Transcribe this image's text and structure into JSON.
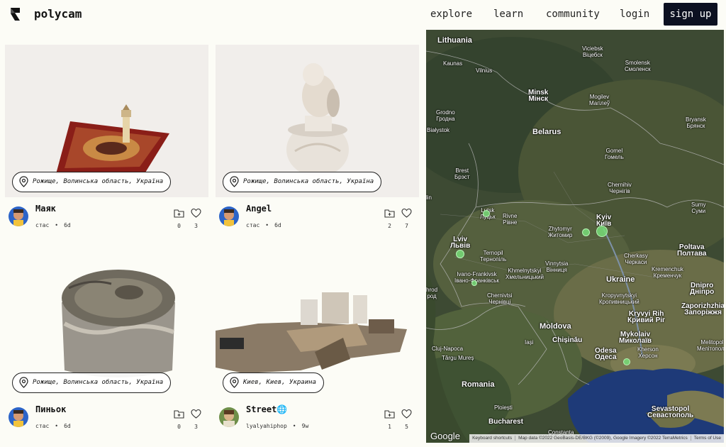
{
  "header": {
    "brand": "polycam",
    "nav": {
      "explore": "explore",
      "learn": "learn",
      "community": "community",
      "login": "login",
      "signup": "sign up"
    }
  },
  "cards": [
    {
      "title": "Маяк",
      "location": "Рожище, Волинська область, Україна",
      "user": "стас",
      "age": "6d",
      "collections": "0",
      "likes": "3",
      "thumb_icon": "carpet-lighthouse-model"
    },
    {
      "title": "Angel",
      "location": "Рожище, Волинська область, Україна",
      "user": "стас",
      "age": "6d",
      "collections": "2",
      "likes": "7",
      "thumb_icon": "angel-figurine-model"
    },
    {
      "title": "Пиньок",
      "location": "Рожище, Волинська область, Україна",
      "user": "стас",
      "age": "6d",
      "collections": "0",
      "likes": "3",
      "thumb_icon": "tree-stump-model"
    },
    {
      "title": "Street🌐",
      "location": "Киев, Киев, Украина",
      "user": "lyalyahiphop",
      "age": "9w",
      "collections": "1",
      "likes": "5",
      "thumb_icon": "street-scan-model"
    }
  ],
  "map": {
    "labels": {
      "lithuania": "Lithuania",
      "kaunas": "Kaunas",
      "vilnius": "Vilnius",
      "vitebsk": "Viciebsk\nВiцебск",
      "smolensk": "Smolensk\nСмоленск",
      "minsk": "Minsk\nМiнск",
      "mogilev": "Mogilev\nМагiлеў",
      "grodno": "Grodno\nГродна",
      "belarus": "Belarus",
      "bialystok": "Białystok",
      "bryansk": "Bryansk\nБрянск",
      "gomel": "Gomel\nГомель",
      "brest": "Brest\nБрэст",
      "chernihiv": "Chernihiv\nЧернiгiв",
      "sumy": "Sumy\nСуми",
      "lutsk": "Lutsk\nЛуцьк",
      "rivne": "Rivne\nРiвне",
      "kyiv": "Kyiv\nКиїв",
      "lublin": "lin",
      "zhytomyr": "Zhytomyr\nЖитомир",
      "lviv": "Lviv\nЛьвiв",
      "ternopil": "Ternopil\nТернопiль",
      "poltava": "Poltava\nПолтава",
      "vinnytsia": "Vinnytsia\nВiнниця",
      "cherkasy": "Cherkasy\nЧеркаси",
      "ivano": "Ivano-Frankivsk\nIвано-Франкiвськ",
      "khmelnytskyi": "Khmelnytskyi\nХмельницький",
      "kremenchuk": "Kremenchuk\nКременчук",
      "ukraine": "Ukraine",
      "dnipro": "Dnipro\nДнiпро",
      "kropyvnytskyi": "Kropyvnytskyi\nКропивницький",
      "chernivtsi": "Chernivtsi\nЧернiвцi",
      "uzhhorod": "hrod\nрод",
      "zaporizhzhia": "Zaporizhzhia\nЗапорiжжя",
      "kryvyi": "Kryvyi Rih\nКривий Рiг",
      "moldova": "Moldova",
      "iasi": "Iași",
      "chisinau": "Chișinău",
      "mykolaiv": "Mykolaiv\nМиколаїв",
      "melitopol": "Melitopol\nМелiтополь",
      "cluj": "Cluj-Napoca",
      "odesa": "Odesa\nОдеса",
      "kherson": "Kherson\nХерсон",
      "targu": "Târgu Mureș",
      "romania": "Romania",
      "sevastopol": "Sevastopol\nСевастополь",
      "ploiesti": "Ploiești",
      "bucharest": "Bucharest",
      "constanta": "Constanța"
    },
    "google": "Google",
    "attribution": {
      "shortcuts": "Keyboard shortcuts",
      "data": "Map data ©2022 GeoBasis-DE/BKG (©2009), Google Imagery ©2022 TerraMetrics",
      "terms": "Terms of Use"
    },
    "marker_color": "#78dc78"
  }
}
